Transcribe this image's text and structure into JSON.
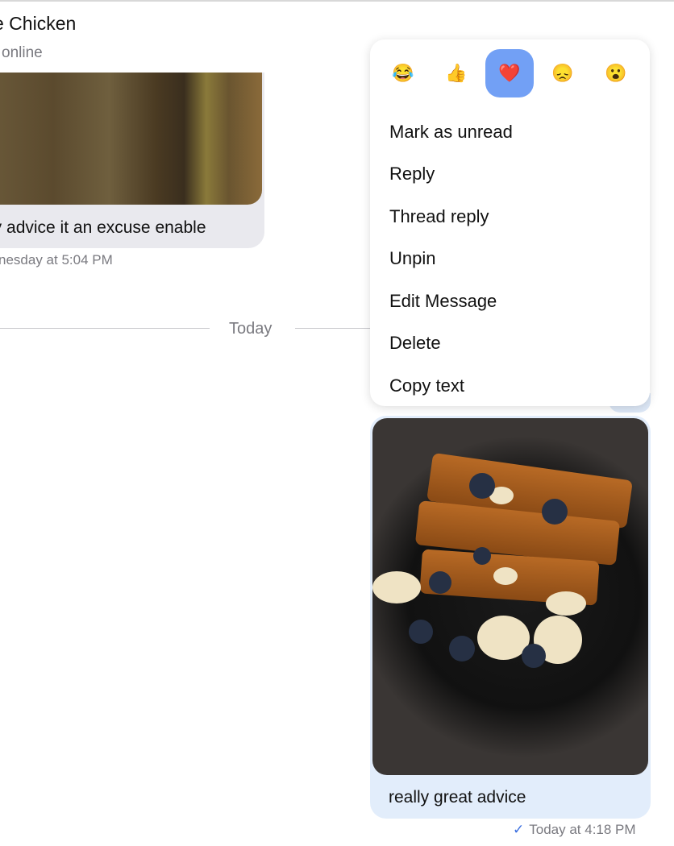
{
  "header": {
    "title": "e Chicken",
    "status": "online"
  },
  "incoming": {
    "text": "ay advice it an excuse enable",
    "time": "nesday at 5:04 PM"
  },
  "divider": {
    "label": "Today"
  },
  "context_menu": {
    "reactions": [
      {
        "icon": "😂",
        "name": "tears-of-joy"
      },
      {
        "icon": "👍",
        "name": "thumbs-up"
      },
      {
        "icon": "❤️",
        "name": "heart",
        "selected": true
      },
      {
        "icon": "😞",
        "name": "disappointed"
      },
      {
        "icon": "😮",
        "name": "surprised"
      }
    ],
    "items": [
      "Mark as unread",
      "Reply",
      "Thread reply",
      "Unpin",
      "Edit Message",
      "Delete",
      "Copy text"
    ]
  },
  "outgoing": {
    "text": "really great advice",
    "time": "Today at 4:18 PM",
    "status_icon": "✓"
  },
  "colors": {
    "selected_reaction": "#72a0f5",
    "outgoing_bubble": "#e2edfb",
    "incoming_bubble": "#e9e9ee"
  }
}
